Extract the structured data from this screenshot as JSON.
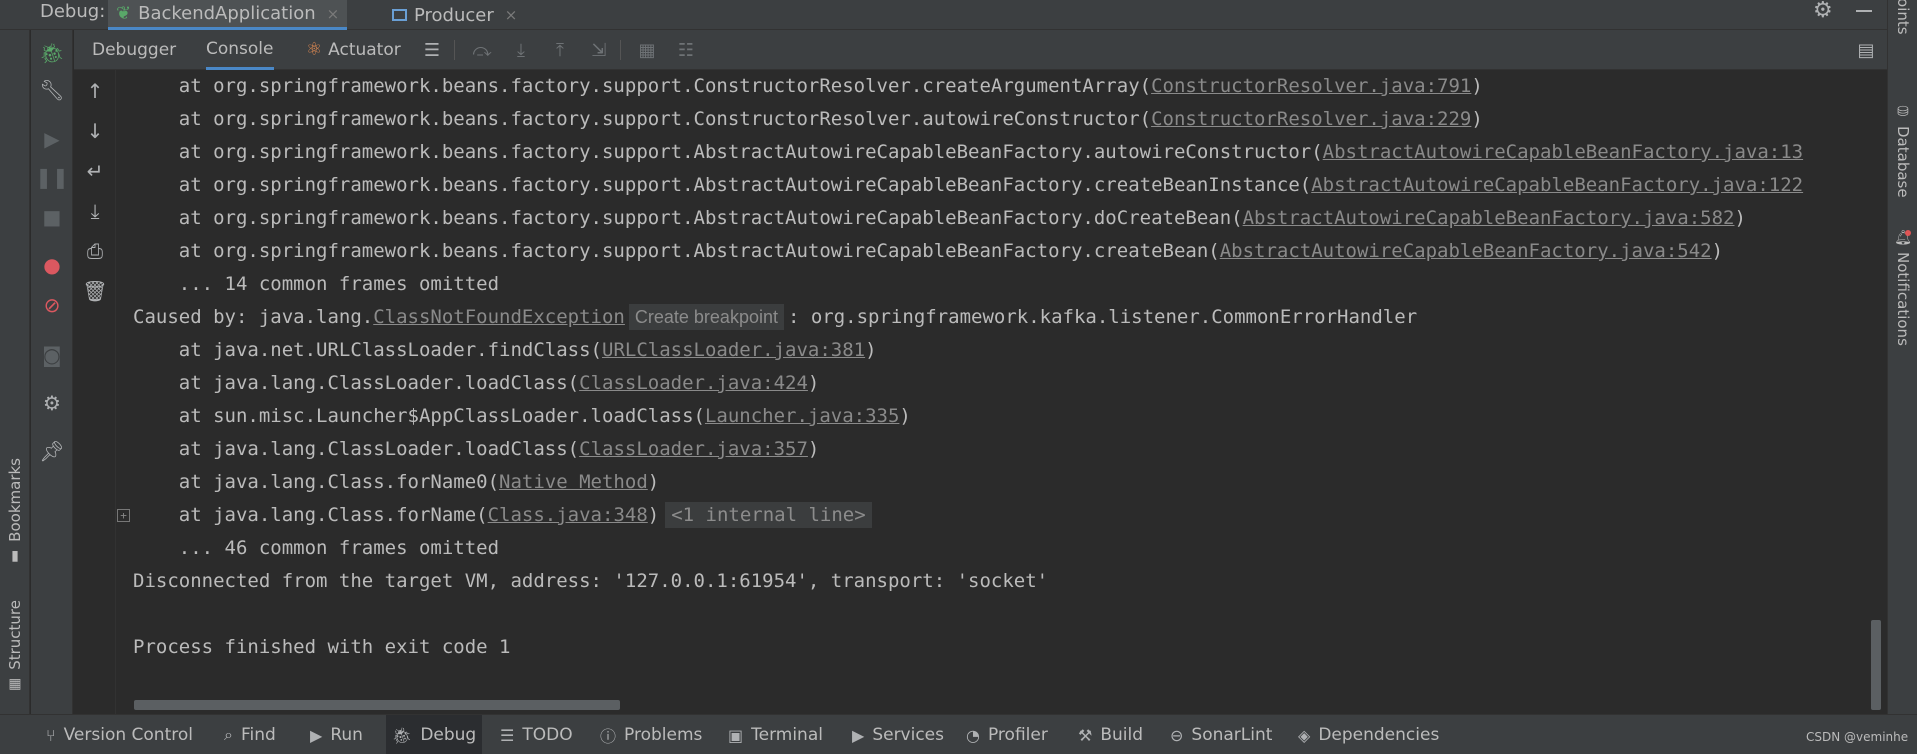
{
  "header": {
    "debug_label": "Debug:",
    "tabs": [
      {
        "label": "BackendApplication",
        "icon": "spring-run-icon",
        "active": true
      },
      {
        "label": "Producer",
        "icon": "app-window-icon",
        "active": false
      }
    ],
    "close_glyph": "×"
  },
  "left_stripe": {
    "bookmarks": "Bookmarks",
    "structure": "Structure"
  },
  "right_stripe": {
    "endpoints": "Endpoints",
    "database": "Database",
    "notifications": "Notifications"
  },
  "debugger_tabs": [
    {
      "label": "Debugger",
      "active": false
    },
    {
      "label": "Console",
      "active": true
    },
    {
      "label": "Actuator",
      "active": false,
      "icon": "actuator-icon"
    }
  ],
  "console": {
    "lines": [
      {
        "text": "    at org.springframework.beans.factory.support.ConstructorResolver.createArgumentArray(",
        "link": "ConstructorResolver.java:791",
        "tail": ")"
      },
      {
        "text": "    at org.springframework.beans.factory.support.ConstructorResolver.autowireConstructor(",
        "link": "ConstructorResolver.java:229",
        "tail": ")"
      },
      {
        "text": "    at org.springframework.beans.factory.support.AbstractAutowireCapableBeanFactory.autowireConstructor(",
        "link": "AbstractAutowireCapableBeanFactory.java:13",
        "tail": ""
      },
      {
        "text": "    at org.springframework.beans.factory.support.AbstractAutowireCapableBeanFactory.createBeanInstance(",
        "link": "AbstractAutowireCapableBeanFactory.java:122",
        "tail": ""
      },
      {
        "text": "    at org.springframework.beans.factory.support.AbstractAutowireCapableBeanFactory.doCreateBean(",
        "link": "AbstractAutowireCapableBeanFactory.java:582",
        "tail": ")"
      },
      {
        "text": "    at org.springframework.beans.factory.support.AbstractAutowireCapableBeanFactory.createBean(",
        "link": "AbstractAutowireCapableBeanFactory.java:542",
        "tail": ")"
      },
      {
        "text": "    ... 14 common frames omitted",
        "link": "",
        "tail": ""
      },
      {
        "text": "Caused by: java.lang.",
        "link": "ClassNotFoundException",
        "hint": "Create breakpoint",
        "tail": ": org.springframework.kafka.listener.CommonErrorHandler"
      },
      {
        "text": "    at java.net.URLClassLoader.findClass(",
        "link": "URLClassLoader.java:381",
        "tail": ")"
      },
      {
        "text": "    at java.lang.ClassLoader.loadClass(",
        "link": "ClassLoader.java:424",
        "tail": ")"
      },
      {
        "text": "    at sun.misc.Launcher$AppClassLoader.loadClass(",
        "link": "Launcher.java:335",
        "tail": ")"
      },
      {
        "text": "    at java.lang.ClassLoader.loadClass(",
        "link": "ClassLoader.java:357",
        "tail": ")"
      },
      {
        "text": "    at java.lang.Class.forName0(",
        "link": "Native Method",
        "tail": ")"
      },
      {
        "text": "    at java.lang.Class.forName(",
        "link": "Class.java:348",
        "tail": ")",
        "folded": "<1 internal line>"
      },
      {
        "text": "    ... 46 common frames omitted",
        "link": "",
        "tail": ""
      },
      {
        "text": "Disconnected from the target VM, address: '127.0.0.1:61954', transport: 'socket'",
        "link": "",
        "tail": ""
      },
      {
        "text": "",
        "link": "",
        "tail": ""
      },
      {
        "text": "Process finished with exit code 1",
        "link": "",
        "tail": ""
      }
    ]
  },
  "bottom_bar": [
    {
      "label": "Version Control",
      "icon": "branch-icon"
    },
    {
      "label": "Find",
      "icon": "search-icon"
    },
    {
      "label": "Run",
      "icon": "run-icon"
    },
    {
      "label": "Debug",
      "icon": "bug-icon",
      "active": true
    },
    {
      "label": "TODO",
      "icon": "list-icon"
    },
    {
      "label": "Problems",
      "icon": "info-icon"
    },
    {
      "label": "Terminal",
      "icon": "terminal-icon"
    },
    {
      "label": "Services",
      "icon": "services-icon"
    },
    {
      "label": "Profiler",
      "icon": "profiler-icon"
    },
    {
      "label": "Build",
      "icon": "hammer-icon"
    },
    {
      "label": "SonarLint",
      "icon": "sonarlint-icon"
    },
    {
      "label": "Dependencies",
      "icon": "layers-icon"
    }
  ],
  "watermark": "CSDN @veminhe",
  "colors": {
    "background": "#2b2b2b",
    "panel": "#3c3f41",
    "text": "#bbbbbb",
    "link": "#8a8a8a",
    "accent": "#4a88c7",
    "bug_green": "#59a869",
    "breakpoint_red": "#db5860"
  }
}
